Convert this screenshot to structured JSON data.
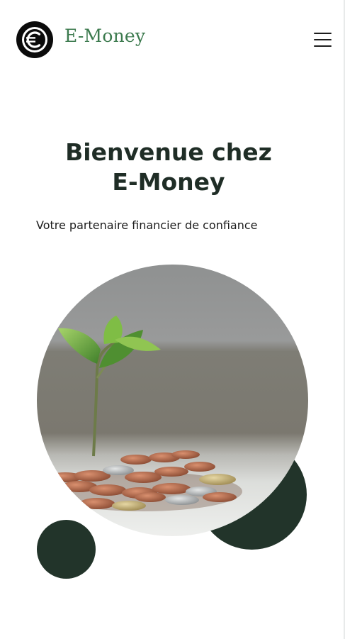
{
  "header": {
    "brand_name": "E-Money",
    "logo_icon": "euro-coin-icon",
    "menu_icon": "hamburger-menu-icon"
  },
  "hero": {
    "title_line1": "Bienvenue chez",
    "title_line2": "E-Money",
    "subtitle": "Votre partenaire financier de confiance",
    "image_subject": "plant-sprout-on-coins"
  },
  "colors": {
    "brand_green": "#3c7a4e",
    "dark_green": "#22342a",
    "text_dark": "#1f2d26"
  }
}
